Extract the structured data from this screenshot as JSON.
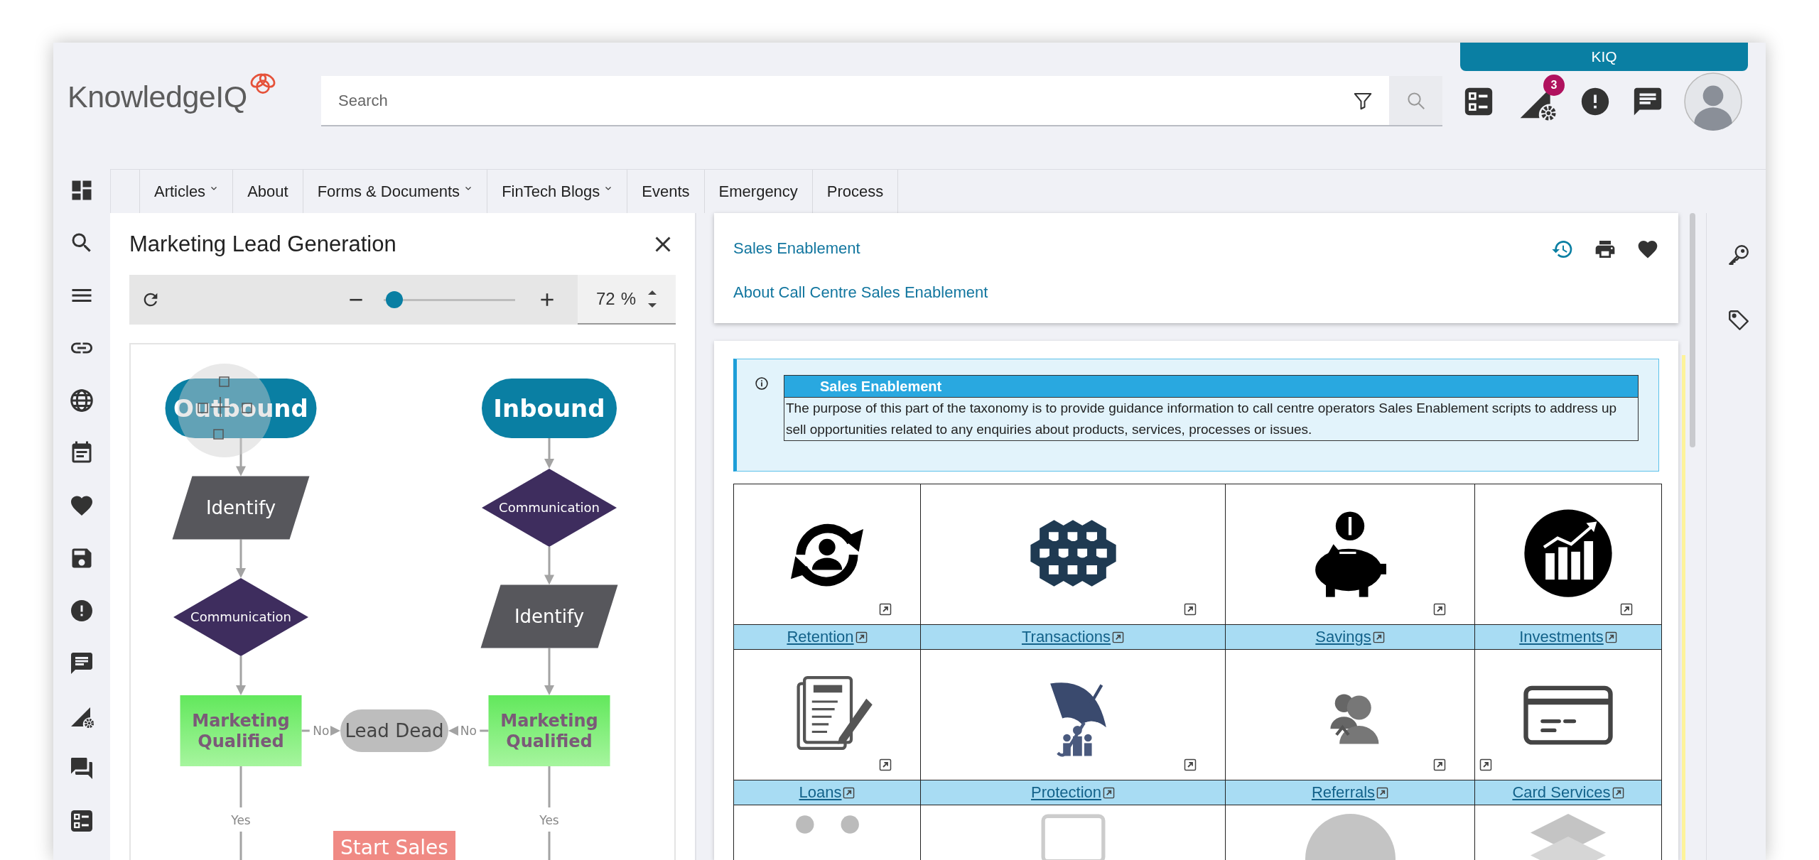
{
  "header": {
    "logo": "KnowledgeIQ",
    "search": {
      "placeholder": "Search"
    },
    "kiq_tab": "KIQ",
    "notification_badge": "3"
  },
  "nav": [
    {
      "label": "Articles",
      "dropdown": true
    },
    {
      "label": "About",
      "dropdown": false
    },
    {
      "label": "Forms & Documents",
      "dropdown": true
    },
    {
      "label": "FinTech Blogs",
      "dropdown": true
    },
    {
      "label": "Events",
      "dropdown": false
    },
    {
      "label": "Emergency",
      "dropdown": false
    },
    {
      "label": "Process",
      "dropdown": false
    }
  ],
  "diagram_panel": {
    "title": "Marketing Lead Generation",
    "zoom": {
      "level": 0.08,
      "value": "72",
      "unit": "%"
    },
    "nodes": [
      {
        "kind": "terminal",
        "text": "Outbound"
      },
      {
        "kind": "terminal",
        "text": "Inbound"
      },
      {
        "kind": "data",
        "text": "Identify"
      },
      {
        "kind": "decision",
        "text": "Communication"
      },
      {
        "kind": "decision",
        "text": "Communication"
      },
      {
        "kind": "data",
        "text": "Identify"
      },
      {
        "kind": "process",
        "text": "Marketing Qualified"
      },
      {
        "kind": "end",
        "text": "Lead Dead"
      },
      {
        "kind": "process",
        "text": "Marketing Qualified"
      },
      {
        "kind": "action",
        "text": "Start Sales"
      }
    ],
    "edge_labels": [
      "No",
      "No",
      "Yes",
      "Yes"
    ]
  },
  "article": {
    "breadcrumb": "Sales Enablement",
    "title": "About Call Centre Sales Enablement",
    "info": {
      "heading": "Sales Enablement",
      "text": "The purpose of this part of the taxonomy is to provide guidance information to call centre operators Sales Enablement scripts to address up sell opportunities related to any enquiries about products, services,  processes or issues."
    },
    "tiles": [
      {
        "label": "Retention"
      },
      {
        "label": "Transactions"
      },
      {
        "label": "Savings"
      },
      {
        "label": "Investments"
      },
      {
        "label": "Loans"
      },
      {
        "label": "Protection"
      },
      {
        "label": "Referrals"
      },
      {
        "label": "Card Services"
      }
    ]
  }
}
